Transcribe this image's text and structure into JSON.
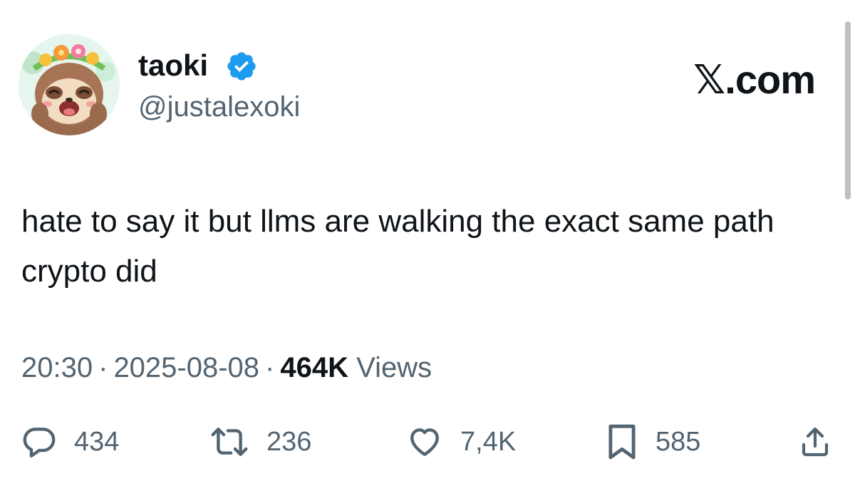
{
  "author": {
    "display_name": "taoki",
    "handle": "@justalexoki",
    "verified": true,
    "avatar_icon": "sloth-avatar-icon"
  },
  "brand": {
    "label": "𝕏.com"
  },
  "tweet": {
    "text": "hate to say it but llms are walking the exact same path crypto did"
  },
  "meta": {
    "time": "20:30",
    "separator": "·",
    "date": "2025-08-08",
    "views_count": "464K",
    "views_label": "Views"
  },
  "actions": {
    "reply": {
      "icon": "reply-icon",
      "count": "434"
    },
    "retweet": {
      "icon": "retweet-icon",
      "count": "236"
    },
    "like": {
      "icon": "heart-icon",
      "count": "7,4K"
    },
    "bookmark": {
      "icon": "bookmark-icon",
      "count": "585"
    },
    "share": {
      "icon": "share-icon"
    }
  },
  "colors": {
    "text_primary": "#0f1419",
    "text_secondary": "#536471",
    "verified_blue": "#1d9bf0"
  }
}
